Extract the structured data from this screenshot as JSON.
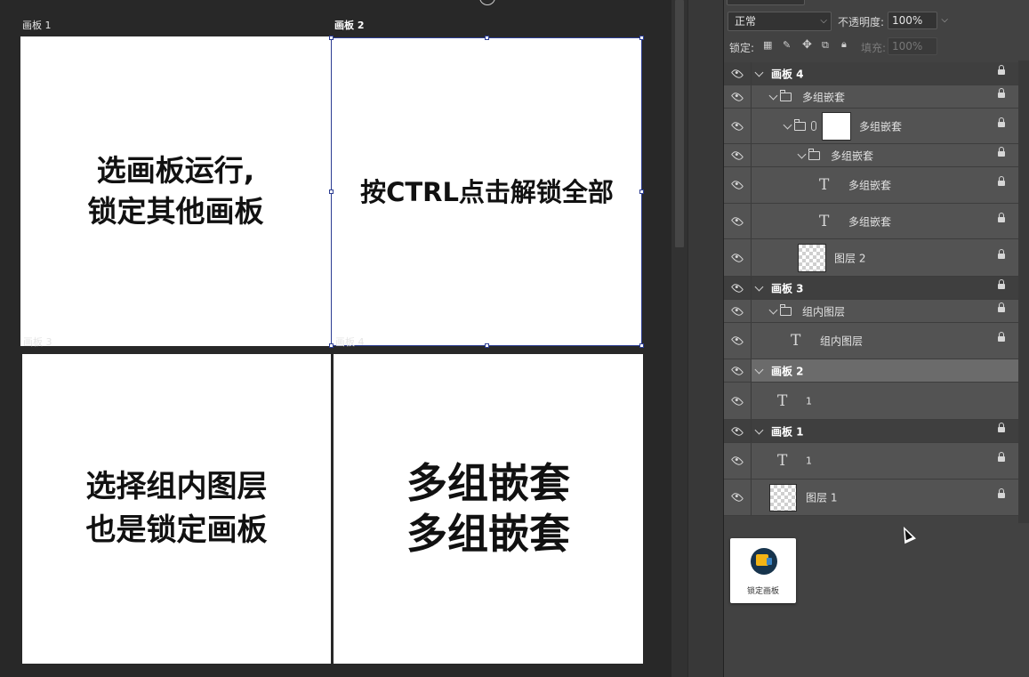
{
  "canvas": {
    "artboards": [
      {
        "label": "画板 1",
        "text": "选画板运行,\n锁定其他画板",
        "selected": false
      },
      {
        "label": "画板 2",
        "text": "按CTRL点击解锁全部",
        "selected": true
      },
      {
        "label": "画板 3",
        "text": "选择组内图层\n也是锁定画板",
        "selected": false
      },
      {
        "label": "画板 4",
        "text": "多组嵌套\n多组嵌套",
        "selected": false
      }
    ]
  },
  "layers_panel": {
    "blend_mode": "正常",
    "opacity_label": "不透明度:",
    "opacity_value": "100%",
    "lock_label": "锁定:",
    "fill_label": "填充:",
    "fill_value": "100%",
    "layers": [
      {
        "name": "画板 4",
        "kind": "artboard",
        "indent": 0
      },
      {
        "name": "多组嵌套",
        "kind": "group",
        "indent": 1
      },
      {
        "name": "多组嵌套",
        "kind": "group-mask",
        "indent": 2
      },
      {
        "name": "多组嵌套",
        "kind": "group",
        "indent": 3
      },
      {
        "name": "多组嵌套",
        "kind": "text",
        "indent": 4
      },
      {
        "name": "多组嵌套",
        "kind": "text",
        "indent": 4
      },
      {
        "name": "图层 2",
        "kind": "pixel",
        "indent": 3
      },
      {
        "name": "画板 3",
        "kind": "artboard",
        "indent": 0
      },
      {
        "name": "组内图层",
        "kind": "group",
        "indent": 1
      },
      {
        "name": "组内图层",
        "kind": "text",
        "indent": 2
      },
      {
        "name": "画板 2",
        "kind": "artboard",
        "indent": 0,
        "selected": true
      },
      {
        "name": "1",
        "kind": "text",
        "indent": 1
      },
      {
        "name": "画板 1",
        "kind": "artboard",
        "indent": 0
      },
      {
        "name": "1",
        "kind": "text",
        "indent": 1
      },
      {
        "name": "图层 1",
        "kind": "pixel",
        "indent": 1
      }
    ]
  },
  "plugin": {
    "label": "锁定画板"
  },
  "icons": [
    "eye-icon",
    "chevron-down-icon",
    "folder-icon",
    "text-layer-icon",
    "lock-icon",
    "link-icon",
    "lock-artboard-plugin-icon"
  ],
  "colors": {
    "selection": "#2c3d92",
    "panel_bg": "#424242",
    "canvas_bg": "#282828"
  }
}
